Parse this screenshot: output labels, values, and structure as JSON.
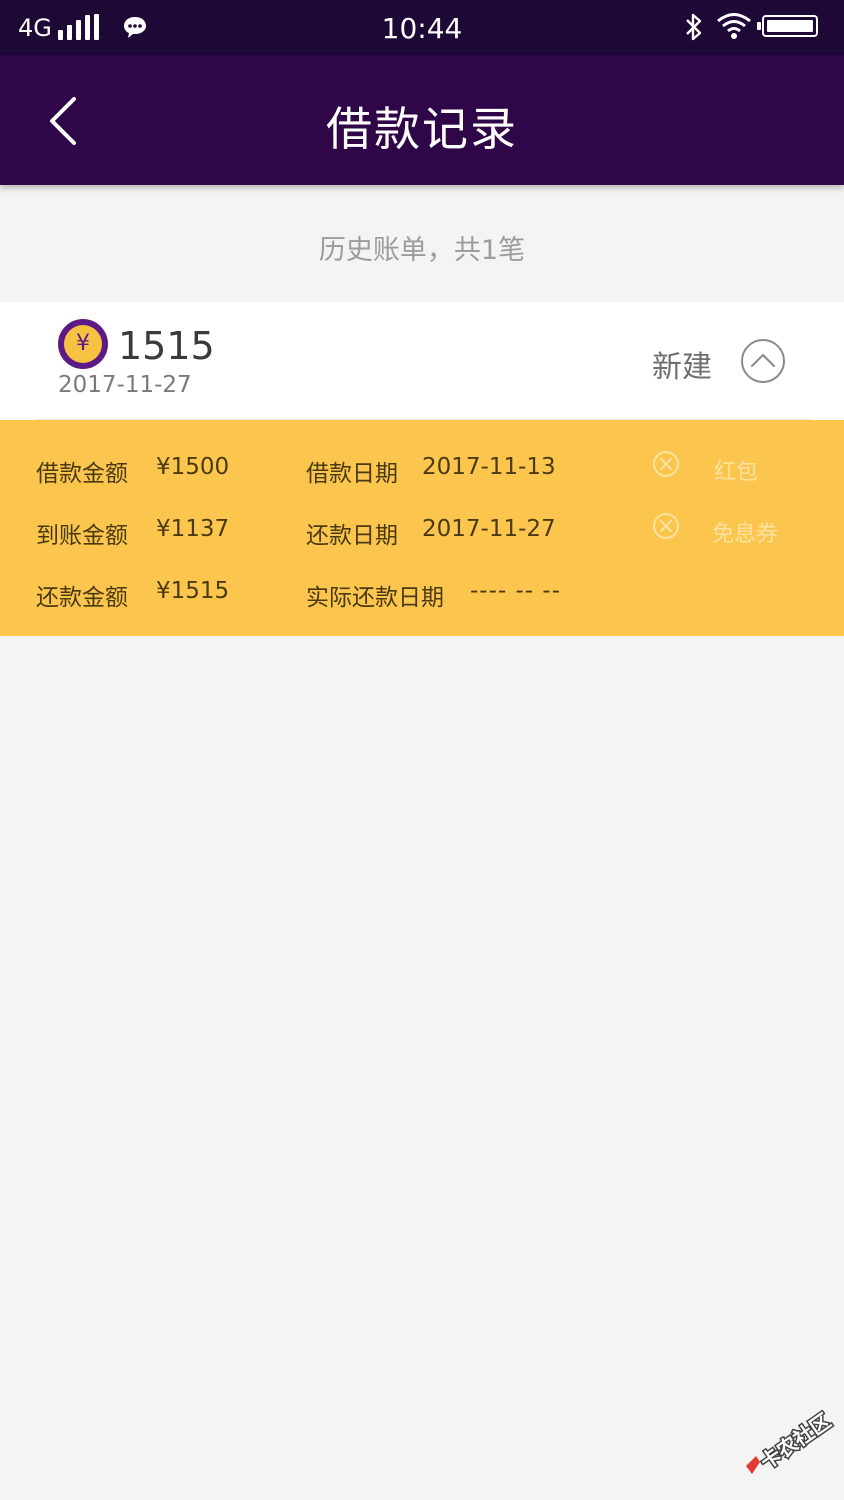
{
  "status_bar": {
    "network": "4G",
    "time": "10:44"
  },
  "header": {
    "title": "借款记录"
  },
  "summary": "历史账单，共1笔",
  "record": {
    "amount": "1515",
    "date": "2017-11-27",
    "status": "新建",
    "coin_symbol": "¥",
    "details": {
      "loan_amount_label": "借款金额",
      "loan_amount_value": "¥1500",
      "received_amount_label": "到账金额",
      "received_amount_value": "¥1137",
      "repay_amount_label": "还款金额",
      "repay_amount_value": "¥1515",
      "loan_date_label": "借款日期",
      "loan_date_value": "2017-11-13",
      "repay_date_label": "还款日期",
      "repay_date_value": "2017-11-27",
      "actual_repay_date_label": "实际还款日期",
      "actual_repay_date_value": "---- -- --",
      "red_packet_label": "红包",
      "interest_free_label": "免息券"
    }
  },
  "watermark": "卡农社区",
  "colors": {
    "status_bar": "#1d0836",
    "app_bar": "#2f0748",
    "detail_panel": "#fcc64e",
    "coin": "#5d1a84",
    "background": "#f4f4f4"
  },
  "icons": [
    "back-arrow-icon",
    "message-icon",
    "bluetooth-icon",
    "wifi-icon",
    "battery-icon",
    "coin-icon",
    "chevron-up-icon",
    "close-circle-icon"
  ]
}
